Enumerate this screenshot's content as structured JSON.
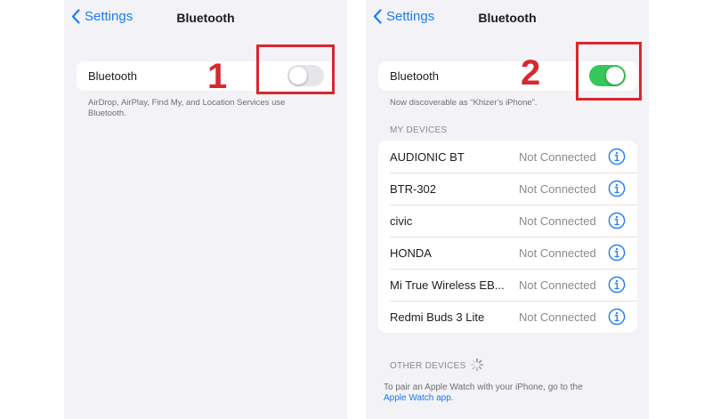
{
  "left": {
    "back_label": "Settings",
    "title": "Bluetooth",
    "toggle_label": "Bluetooth",
    "toggle_state": "off",
    "footnote_line1": "AirDrop, AirPlay, Find My, and Location Services use",
    "footnote_line2": "Bluetooth.",
    "callout_number": "1"
  },
  "right": {
    "back_label": "Settings",
    "title": "Bluetooth",
    "toggle_label": "Bluetooth",
    "toggle_state": "on",
    "discoverable_text": "Now discoverable as “Khizer’s iPhone”.",
    "callout_number": "2",
    "my_devices_header": "MY DEVICES",
    "devices": [
      {
        "name": "AUDIONIC BT",
        "status": "Not Connected"
      },
      {
        "name": "BTR-302",
        "status": "Not Connected"
      },
      {
        "name": "civic",
        "status": "Not Connected"
      },
      {
        "name": "HONDA",
        "status": "Not Connected"
      },
      {
        "name": "Mi True Wireless EB...",
        "status": "Not Connected"
      },
      {
        "name": "Redmi Buds 3 Lite",
        "status": "Not Connected"
      }
    ],
    "other_devices_header": "OTHER DEVICES",
    "watch_note": "To pair an Apple Watch with your iPhone, go to the",
    "watch_link": "Apple Watch app."
  },
  "colors": {
    "accent": "#1a7cf4",
    "toggle_on": "#34c759",
    "callout": "#d7282f",
    "background": "#f2f2f7"
  }
}
